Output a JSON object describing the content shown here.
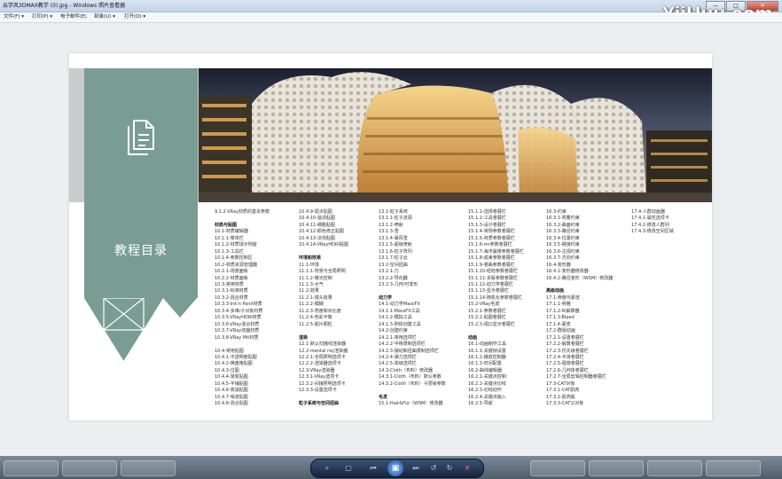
{
  "window": {
    "title": "云学风3DMAX教学 (0).jpg - Windows 照片查看器",
    "watermark": "YiiHuu.com",
    "controls": [
      "—",
      "□",
      "✕"
    ]
  },
  "menubar": {
    "items": [
      "文件(F) ▾",
      "打印(P) ▾",
      "电子邮件(E)",
      "刻录(U) ▾",
      "打开(O) ▾"
    ]
  },
  "page": {
    "heading": "教程目录",
    "toc_columns": [
      [
        "9.1.2-VRay材质的基本参数",
        "",
        "材质与贴图",
        "10.1-材质编辑器",
        "10.1.1-菜单栏",
        "10.1.2-材质球示例窗",
        "10.1.3-工具栏",
        "10.1.4-参数控制区",
        "10.2-材质资源管理器",
        "10.2.1-场景面板",
        "10.2.2-材质面板",
        "10.3-常用材质",
        "10.3.1-标准材质",
        "10.3.2-混合材质",
        "10.3.3-Ink'n Paint材质",
        "10.3.4-多维/子对象材质",
        "10.3.5-VRayHDRI材质",
        "10.3.6-VRay混合材质",
        "10.3.7-VRay双面材质",
        "10.3.8-VRay Mtl材质",
        "",
        "10.4-常用贴图",
        "10.4.1-不透明度贴图",
        "10.4.2-棋盘格贴图",
        "10.4.3-位图",
        "10.4.4-渐变贴图",
        "10.4.5-平铺贴图",
        "10.4.6-衰减贴图",
        "10.4.7-噪波贴图",
        "10.4.8-混合贴图"
      ],
      [
        "10.4.9-斑点贴图",
        "10.4.10-漩涡贴图",
        "10.4.11-细胞贴图",
        "10.4.12-颜色修正贴图",
        "10.4.13-法线贴图",
        "10.4.14-VRayHDRI贴图",
        "",
        "环境和效果",
        "11.1-环境",
        "11.1.1-背景与全局照明",
        "11.1.2-曝光控制",
        "11.1.3-大气",
        "11.2-效果",
        "11.2.1-镜头效果",
        "11.2.2-模糊",
        "11.2.3-亮度和对比度",
        "11.2.4-色彩平衡",
        "11.2.5-胶片颗粒",
        "",
        "渲染",
        "12.1-默认扫描线渲染器",
        "12.2-mental ray渲染器",
        "12.2.1-全局照明选项卡",
        "12.2.2-渲染器选项卡",
        "12.3-VRay渲染器",
        "12.3.1-VRay选项卡",
        "12.3.2-间接照明选项卡",
        "12.3.3-设置选项卡",
        "",
        "粒子系统与空间扭曲"
      ],
      [
        "13.1-粒子系统",
        "13.1.1-粒子流源",
        "13.1.2-喷射",
        "13.1.3-雪",
        "13.1.4-暴风雪",
        "13.1.5-超级喷射",
        "13.1.6-粒子阵列",
        "13.1.7-粒子云",
        "13.2-空间扭曲",
        "13.2.1-力",
        "13.2.2-导向器",
        "13.2.3-几何/可变形",
        "",
        "动力学",
        "14.1-动力学MassFX",
        "14.1.1-MassFX工具",
        "14.1.2-模拟工具",
        "14.1.3-刚体创建工具",
        "14.2-创建约束",
        "14.2.1-常用选项栏",
        "14.2.2-平移限制选项栏",
        "14.2.3-摆动和扭曲限制选项栏",
        "14.2.4-弹力选项栏",
        "14.2.5-高级选项栏",
        "14.3-Cloth（布料）修改器",
        "14.3.1-Cloth（布料）默认参数",
        "14.3.2-Cloth（布料）子层级参数",
        "",
        "毛发",
        "15.1-Hair&Fur（WSM）修改器"
      ],
      [
        "15.1.1-选择卷展栏",
        "15.1.2-工具卷展栏",
        "15.1.3-设计卷展栏",
        "15.1.4-常规参数卷展栏",
        "15.1.5-材质参数卷展栏",
        "15.1.6-mr参数卷展栏",
        "15.1.7-海市蜃楼参数卷展栏",
        "15.1.8-成束参数卷展栏",
        "15.1.9-卷曲参数卷展栏",
        "15.1.10-纽结参数卷展栏",
        "15.1.11-多股参数卷展栏",
        "15.1.12-动力学卷展栏",
        "15.1.13-显示卷展栏",
        "15.1.14-随机化参数卷展栏",
        "15.2-VRay毛皮",
        "15.2.1-参数卷展栏",
        "15.2.2-贴图卷展栏",
        "15.2.3-视口显示卷展栏",
        "",
        "动画",
        "16.1-动画制作工具",
        "16.1.1-关键帧设置",
        "16.1.2-播放控制器",
        "16.1.3-时间配置",
        "16.2-曲线编辑器",
        "16.2.1-关键点控制",
        "16.2.2-关键点切线",
        "16.2.3-切线动作",
        "16.2.4-关键点输入",
        "16.2.5-导航"
      ],
      [
        "16.3-约束",
        "16.3.1-附着约束",
        "16.3.2-曲面约束",
        "16.3.3-路径约束",
        "16.3.4-位置约束",
        "16.3.5-链接约束",
        "16.3.6-注视约束",
        "16.3.7-方向约束",
        "16.4-变形器",
        "16.4.1-变形器修改器",
        "16.4.2-路径变形（WSM）修改器",
        "",
        "高级动画",
        "17.1-骨骼与蒙皮",
        "17.1.1-骨骼",
        "17.1.2-IK解算器",
        "17.1.3-Biped",
        "17.1.4-蒙皮",
        "17.2-群组动画",
        "17.2.1-设置卷展栏",
        "17.2.2-解算卷展栏",
        "17.2.3-优先级卷展栏",
        "17.2.4-平滑卷展栏",
        "17.2.5-碰撞卷展栏",
        "17.2.6-几何体卷展栏",
        "17.2.7-全局剪辑控制器卷展栏",
        "17.3-CAT对象",
        "17.3.1-CAT肌肉",
        "17.3.2-肌肉股",
        "17.3.3-CAT父对象"
      ],
      [
        "17.4-人群动画器",
        "17.4.1-属性选项卡",
        "17.4.2-修改人群列",
        "17.4.3-修改空间区域"
      ]
    ]
  },
  "taskbar": {
    "controls": [
      "放大/缩小",
      "实际大小",
      "上一个",
      "幻灯片放映",
      "下一个",
      "逆时针旋转",
      "顺时针旋转",
      "删除"
    ]
  }
}
